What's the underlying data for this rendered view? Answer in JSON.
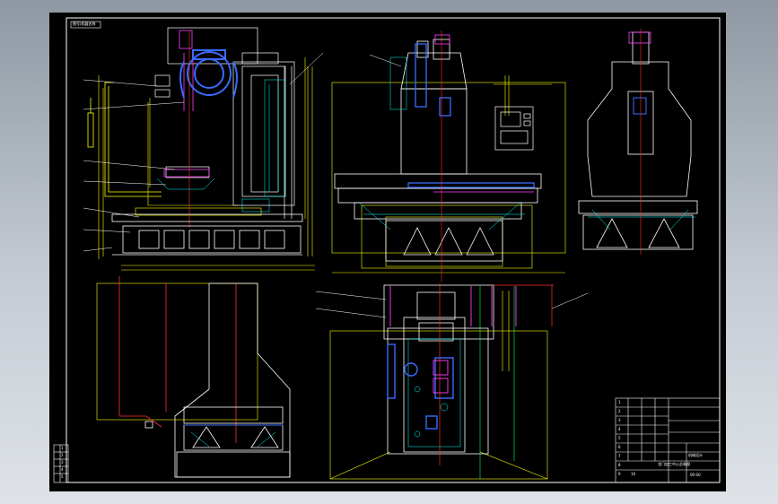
{
  "drawing": {
    "title_tag": "图号/机器名称",
    "revision_block": [
      "1",
      "2",
      "3",
      "4",
      "5"
    ],
    "title_block": {
      "rows": [
        "1",
        "2",
        "3",
        "4",
        "5",
        "6",
        "7",
        "8",
        "9",
        "10"
      ],
      "drawing_name": "龙门加工中心总装图",
      "company": "机械设计",
      "drawing_number": "00-00"
    }
  },
  "colors": {
    "background": "#000000",
    "frame": "#ffffff",
    "centerline": "#ff3030",
    "dimension": "#ffff00",
    "outline": "#ffffff",
    "hidden": "#00ffff",
    "component": "#3a6bff",
    "accent": "#ff40ff",
    "green": "#00ff60"
  }
}
